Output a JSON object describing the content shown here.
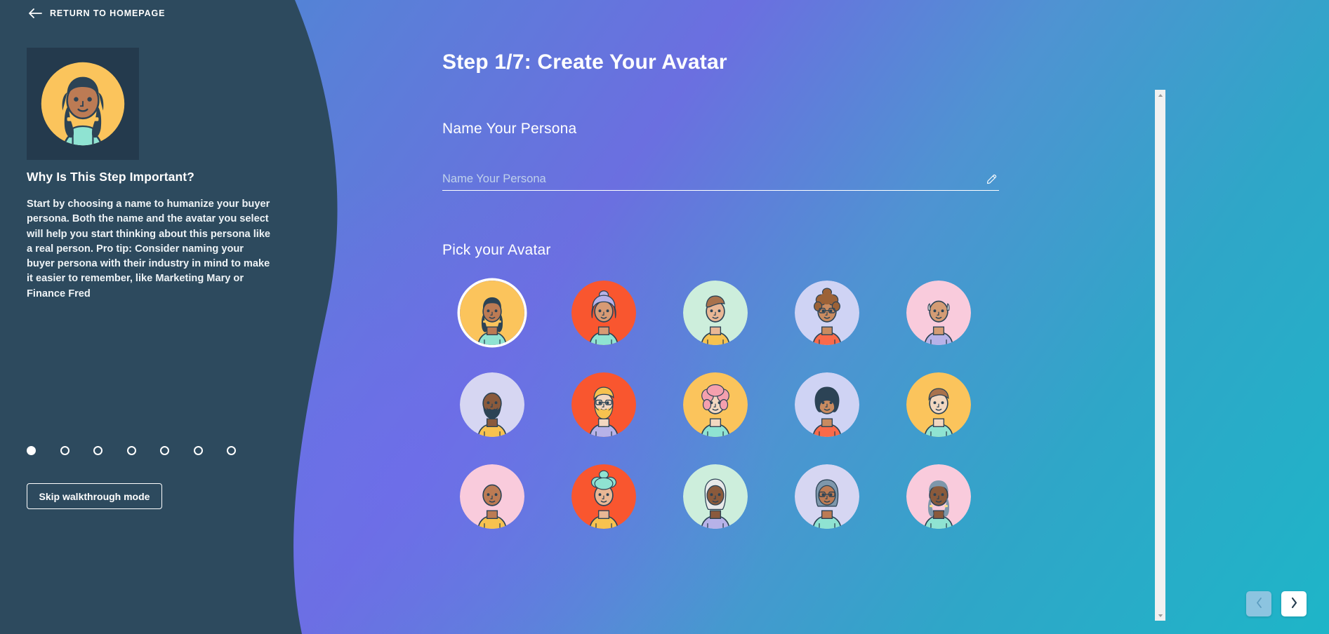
{
  "sidebar": {
    "return_link": {
      "label": "RETURN TO HOMEPAGE",
      "icon": "arrow-left-icon"
    },
    "preview_avatar_alt": "selected-persona-avatar",
    "why_title": "Why Is This Step Important?",
    "why_body": "Start by choosing a name to humanize your buyer persona. Both the name and the avatar you select will help you start thinking about this persona like a real person. Pro tip: Consider naming your buyer persona with their industry in mind to make it easier to remember, like Marketing Mary or Finance Fred",
    "progress": {
      "total_steps": 7,
      "current_step": 1
    },
    "skip_button_label": "Skip walkthrough mode"
  },
  "main": {
    "step_title": "Step 1/7: Create Your Avatar",
    "name_section": {
      "label": "Name Your Persona",
      "input_value": "",
      "input_placeholder": "Name Your Persona",
      "edit_icon": "pencil-icon"
    },
    "avatar_section": {
      "label": "Pick your Avatar",
      "selected_index": 0,
      "avatars": [
        {
          "id": "avatar-1",
          "bg": "#fbc45c",
          "skin": "#bc7b54",
          "hair": "#2c4355",
          "shirt": "#8fe3d2",
          "style": "braids",
          "selected": true
        },
        {
          "id": "avatar-2",
          "bg": "#f9562f",
          "skin": "#d79a74",
          "hair": "#b7b2e8",
          "shirt": "#8fe3d2",
          "style": "bun",
          "selected": false
        },
        {
          "id": "avatar-3",
          "bg": "#cdeedc",
          "skin": "#e9b795",
          "hair": "#a9724c",
          "shirt": "#f7c24f",
          "style": "short-swoop",
          "selected": false
        },
        {
          "id": "avatar-4",
          "bg": "#cfd3f4",
          "skin": "#c98b60",
          "hair": "#9c6237",
          "shirt": "#fa6a4a",
          "style": "curly-bun-glasses",
          "selected": false
        },
        {
          "id": "avatar-5",
          "bg": "#f9cbdc",
          "skin": "#d49c74",
          "hair": "#dcdcdc",
          "shirt": "#b7b2e8",
          "style": "balding",
          "selected": false
        },
        {
          "id": "avatar-6",
          "bg": "#d6d6f2",
          "skin": "#8a5a3c",
          "hair": "#2c4355",
          "shirt": "#f7c24f",
          "style": "bald-beard",
          "selected": false
        },
        {
          "id": "avatar-7",
          "bg": "#f9562f",
          "skin": "#f2d7c0",
          "hair": "#f7c24f",
          "shirt": "#b7b2e8",
          "style": "blond-glasses-beard",
          "selected": false
        },
        {
          "id": "avatar-8",
          "bg": "#fbc45c",
          "skin": "#f2d7c0",
          "hair": "#f4a0ae",
          "shirt": "#8fe3d2",
          "style": "pink-curls",
          "selected": false
        },
        {
          "id": "avatar-9",
          "bg": "#cfd3f4",
          "skin": "#c98b60",
          "hair": "#2c4355",
          "shirt": "#fa6a4a",
          "style": "wavy-dark",
          "selected": false
        },
        {
          "id": "avatar-10",
          "bg": "#fbc45c",
          "skin": "#f2d7c0",
          "hair": "#a9724c",
          "shirt": "#8fe3d2",
          "style": "short-brown",
          "selected": false
        },
        {
          "id": "avatar-11",
          "bg": "#f9cbdc",
          "skin": "#bc7b54",
          "hair": "#bc7b54",
          "shirt": "#f7c24f",
          "style": "bald",
          "selected": false
        },
        {
          "id": "avatar-12",
          "bg": "#f9562f",
          "skin": "#e9b795",
          "hair": "#8fe3d2",
          "shirt": "#f7c24f",
          "style": "mint-curls",
          "selected": false
        },
        {
          "id": "avatar-13",
          "bg": "#cdeedc",
          "skin": "#8a5a3c",
          "hair": "#e8e8e8",
          "shirt": "#b7b2e8",
          "style": "white-long",
          "selected": false
        },
        {
          "id": "avatar-14",
          "bg": "#d6d6f2",
          "skin": "#bc7b54",
          "hair": "#7e97ab",
          "shirt": "#8fe3d2",
          "style": "grey-glasses",
          "selected": false
        },
        {
          "id": "avatar-15",
          "bg": "#f9cbdc",
          "skin": "#8a5a3c",
          "hair": "#7e97ab",
          "shirt": "#8fe3d2",
          "style": "grey-braids",
          "selected": false
        }
      ]
    },
    "nav": {
      "prev_label": "‹",
      "next_label": "›",
      "prev_icon": "chevron-left-icon",
      "next_icon": "chevron-right-icon",
      "prev_enabled": false,
      "next_enabled": true
    },
    "scrollbar": {
      "up_icon": "scroll-up-arrow-icon",
      "down_icon": "scroll-down-arrow-icon"
    }
  },
  "colors": {
    "sidebar_bg": "#2d4a5e",
    "preview_card_bg": "#243a4d",
    "accent_white": "#ffffff",
    "nav_prev_bg": "#8cc4e0",
    "nav_next_bg": "#ffffff"
  }
}
